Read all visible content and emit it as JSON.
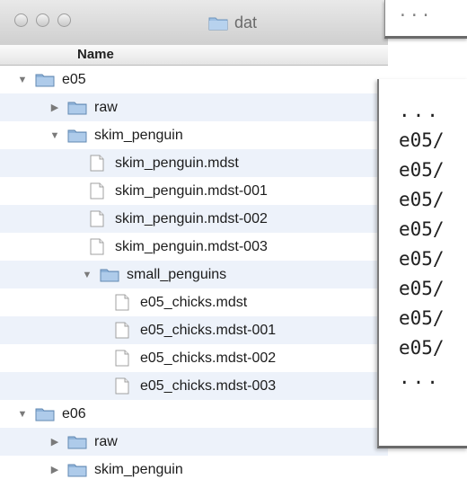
{
  "window": {
    "title": "dat"
  },
  "column_header": {
    "name": "Name"
  },
  "tree": [
    {
      "label": "e05",
      "type": "folder",
      "level": 0,
      "expanded": true
    },
    {
      "label": "raw",
      "type": "folder",
      "level": 1,
      "expanded": false
    },
    {
      "label": "skim_penguin",
      "type": "folder",
      "level": 1,
      "expanded": true
    },
    {
      "label": "skim_penguin.mdst",
      "type": "file",
      "level": 2
    },
    {
      "label": "skim_penguin.mdst-001",
      "type": "file",
      "level": 2
    },
    {
      "label": "skim_penguin.mdst-002",
      "type": "file",
      "level": 2
    },
    {
      "label": "skim_penguin.mdst-003",
      "type": "file",
      "level": 2
    },
    {
      "label": "small_penguins",
      "type": "folder",
      "level": 2,
      "expanded": true
    },
    {
      "label": "e05_chicks.mdst",
      "type": "file",
      "level": 3
    },
    {
      "label": "e05_chicks.mdst-001",
      "type": "file",
      "level": 3
    },
    {
      "label": "e05_chicks.mdst-002",
      "type": "file",
      "level": 3
    },
    {
      "label": "e05_chicks.mdst-003",
      "type": "file",
      "level": 3
    },
    {
      "label": "e06",
      "type": "folder",
      "level": 0,
      "expanded": true
    },
    {
      "label": "raw",
      "type": "folder",
      "level": 1,
      "expanded": false
    },
    {
      "label": "skim_penguin",
      "type": "folder",
      "level": 1,
      "expanded": false
    }
  ],
  "terminal_top": {
    "text": "..."
  },
  "terminal_lines": [
    "...",
    "e05/",
    "e05/",
    "e05/",
    "e05/",
    "e05/",
    "e05/",
    "e05/",
    "e05/",
    "..."
  ],
  "colors": {
    "folder": "#8fb3d9",
    "row_alt": "#edf2fa",
    "titlebar": "#d8d8d8"
  }
}
